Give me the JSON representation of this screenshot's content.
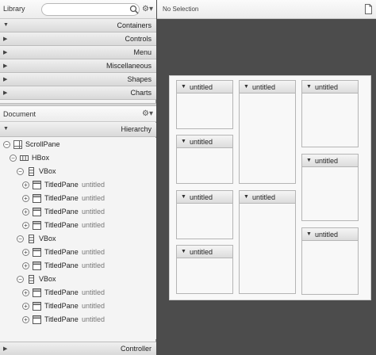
{
  "library": {
    "title": "Library",
    "search_placeholder": "",
    "gear_icon": "gear-icon",
    "sections": [
      {
        "label": "Containers",
        "expanded": false
      },
      {
        "label": "Controls",
        "expanded": false
      },
      {
        "label": "Menu",
        "expanded": false
      },
      {
        "label": "Miscellaneous",
        "expanded": false
      },
      {
        "label": "Shapes",
        "expanded": false
      },
      {
        "label": "Charts",
        "expanded": false
      }
    ]
  },
  "document": {
    "title": "Document",
    "hierarchy_label": "Hierarchy",
    "controller_label": "Controller",
    "tree": [
      {
        "label": "ScrollPane",
        "sub": "",
        "icon": "scrollpane-icon",
        "toggle": "−"
      },
      {
        "label": "HBox",
        "sub": "",
        "icon": "hbox-icon",
        "toggle": "−"
      },
      {
        "label": "VBox",
        "sub": "",
        "icon": "vbox-icon",
        "toggle": "−"
      },
      {
        "label": "TitledPane",
        "sub": "untitled",
        "icon": "titledpane-icon",
        "toggle": "+"
      },
      {
        "label": "TitledPane",
        "sub": "untitled",
        "icon": "titledpane-icon",
        "toggle": "+"
      },
      {
        "label": "TitledPane",
        "sub": "untitled",
        "icon": "titledpane-icon",
        "toggle": "+"
      },
      {
        "label": "TitledPane",
        "sub": "untitled",
        "icon": "titledpane-icon",
        "toggle": "+"
      },
      {
        "label": "VBox",
        "sub": "",
        "icon": "vbox-icon",
        "toggle": "−"
      },
      {
        "label": "TitledPane",
        "sub": "untitled",
        "icon": "titledpane-icon",
        "toggle": "+"
      },
      {
        "label": "TitledPane",
        "sub": "untitled",
        "icon": "titledpane-icon",
        "toggle": "+"
      },
      {
        "label": "VBox",
        "sub": "",
        "icon": "vbox-icon",
        "toggle": "−"
      },
      {
        "label": "TitledPane",
        "sub": "untitled",
        "icon": "titledpane-icon",
        "toggle": "+"
      },
      {
        "label": "TitledPane",
        "sub": "untitled",
        "icon": "titledpane-icon",
        "toggle": "+"
      },
      {
        "label": "TitledPane",
        "sub": "untitled",
        "icon": "titledpane-icon",
        "toggle": "+"
      }
    ]
  },
  "content": {
    "selection_label": "No Selection",
    "panes": [
      {
        "title": "untitled"
      },
      {
        "title": "untitled"
      },
      {
        "title": "untitled"
      },
      {
        "title": "untitled"
      },
      {
        "title": "untitled"
      },
      {
        "title": "untitled"
      },
      {
        "title": "untitled"
      },
      {
        "title": "untitled"
      },
      {
        "title": "untitled"
      }
    ]
  },
  "colors": {
    "workspace_background": "#4c4c4c",
    "panel_background": "#f4f4f4",
    "canvas_background": "#f8f8f8"
  }
}
